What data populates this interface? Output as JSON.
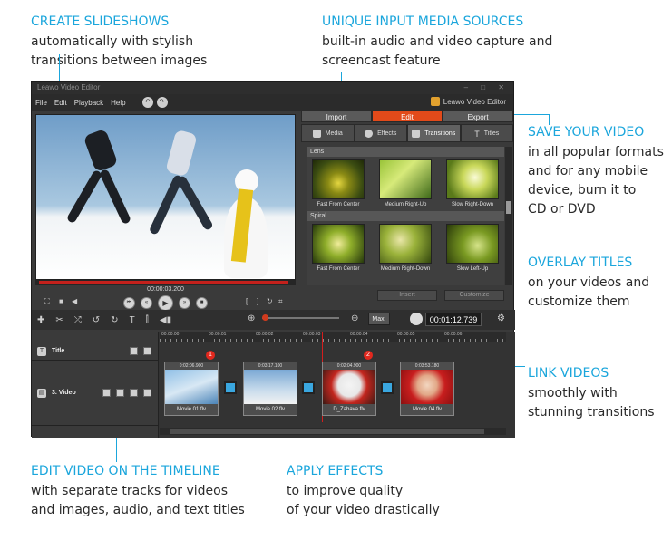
{
  "callouts": {
    "slideshows": {
      "title": "CREATE SLIDESHOWS",
      "line1": "automatically with stylish",
      "line2": "transitions between images"
    },
    "sources": {
      "title": "UNIQUE INPUT MEDIA SOURCES",
      "line1": "built-in audio and video capture and",
      "line2": "screencast feature"
    },
    "save": {
      "title": "SAVE YOUR VIDEO",
      "line1": "in all popular formats",
      "line2": "and for any mobile",
      "line3": "device, burn it to",
      "line4": "CD or DVD"
    },
    "titles": {
      "title": "OVERLAY TITLES",
      "line1": "on your videos and",
      "line2": "customize them"
    },
    "link": {
      "title": "LINK VIDEOS",
      "line1": "smoothly with",
      "line2": "stunning transitions"
    },
    "timeline": {
      "title": "EDIT VIDEO ON THE TIMELINE",
      "line1": "with separate tracks for videos",
      "line2": "and images, audio, and text titles"
    },
    "effects": {
      "title": "APPLY EFFECTS",
      "line1": "to improve quality",
      "line2": "of your video drastically"
    }
  },
  "app": {
    "window_title": "Leawo Video Editor",
    "window_controls": "– □ ✕",
    "brand": "Leawo Video Editor",
    "menu": [
      "File",
      "Edit",
      "Playback",
      "Help"
    ],
    "preview_time": "00:00:03.200",
    "main_tabs": [
      "Import",
      "Edit",
      "Export"
    ],
    "active_main_tab": "Edit",
    "sub_tabs": [
      "Media",
      "Effects",
      "Transitions",
      "Titles"
    ],
    "active_sub_tab": "Transitions",
    "sections": [
      {
        "name": "Lens",
        "items": [
          "Fast From Center",
          "Medium Right-Up",
          "Slow Right-Down"
        ]
      },
      {
        "name": "Spiral",
        "items": [
          "Fast From Center",
          "Medium Right-Down",
          "Slow Left-Up"
        ]
      }
    ],
    "gallery_buttons": [
      "Insert",
      "Customize"
    ],
    "toolbar": {
      "max_label": "Max.",
      "time": "00:01:12.739"
    },
    "ruler_ticks": [
      "00:00:00",
      "00:00:01",
      "00:00:02",
      "00:00:03",
      "00:00:04",
      "00:00:05",
      "00:00:06"
    ],
    "tracks": [
      {
        "label": "Title"
      },
      {
        "label": "3. Video"
      }
    ],
    "clips": [
      {
        "time": "0:02:06.900",
        "name": "Movie 01.flv"
      },
      {
        "time": "0:03:17.100",
        "name": "Movie 02.flv"
      },
      {
        "time": "0:02:04.900",
        "name": "D_Zabava.flv"
      },
      {
        "time": "0:03:53.180",
        "name": "Movie 04.flv"
      }
    ],
    "badges": [
      "1",
      "2"
    ]
  },
  "colors": {
    "accent": "#1ba6dc",
    "active_tab": "#e24a1a",
    "playhead": "#d41e1e"
  }
}
